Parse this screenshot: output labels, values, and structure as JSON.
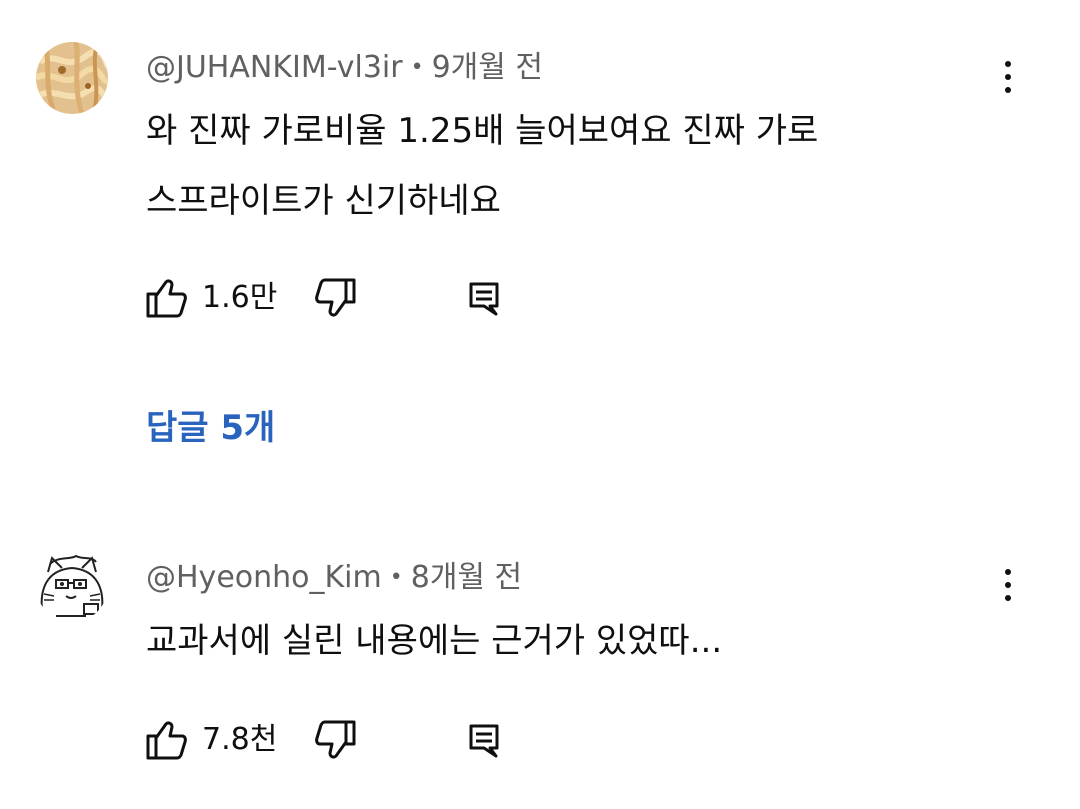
{
  "comments": [
    {
      "author": "@JUHANKIM-vl3ir",
      "time": "9개월 전",
      "lines": [
        "와 진짜 가로비율 1.25배 늘어보여요 진짜 가로",
        "스프라이트가 신기하네요"
      ],
      "likes": "1.6만",
      "replies_label": "답글 5개",
      "avatar_icon": "noodle-photo-avatar"
    },
    {
      "author": "@Hyeonho_Kim",
      "time": "8개월 전",
      "lines": [
        "교과서에 실린 내용에는 근거가 있었따..."
      ],
      "likes": "7.8천",
      "avatar_icon": "cartoon-cat-avatar"
    }
  ],
  "icons": {
    "like": "thumbs-up-icon",
    "dislike": "thumbs-down-icon",
    "reply": "comment-reply-icon",
    "more": "vertical-dots-icon"
  },
  "colors": {
    "text": "#0f0f0f",
    "meta": "#606060",
    "link": "#2a63bd"
  }
}
